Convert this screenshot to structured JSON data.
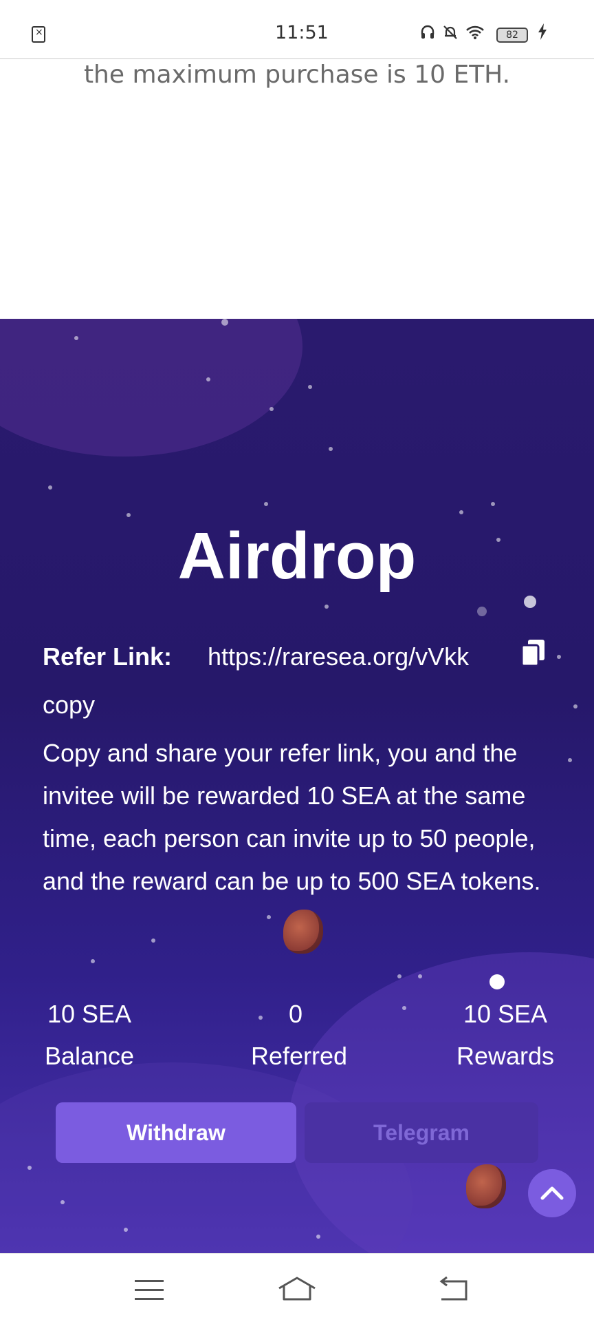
{
  "status_bar": {
    "time": "11:51",
    "battery": "82",
    "icons": [
      "document-x-icon",
      "headphones-icon",
      "bell-off-icon",
      "wifi-icon",
      "battery-icon",
      "charging-icon"
    ]
  },
  "page": {
    "top_text": "the maximum purchase is 10 ETH."
  },
  "airdrop": {
    "title": "Airdrop",
    "refer_label": "Refer Link:",
    "refer_link": "https://raresea.org/vVkk",
    "copy_text": "copy",
    "description": "Copy and share your refer link, you and the invitee will be rewarded 10 SEA at the same time, each person can invite up to 50 people, and the reward can be up to 500 SEA tokens.",
    "stats": [
      {
        "value": "10 SEA",
        "label": "Balance"
      },
      {
        "value": "0",
        "label": "Referred"
      },
      {
        "value": "10 SEA",
        "label": "Rewards"
      }
    ],
    "withdraw_label": "Withdraw",
    "telegram_label": "Telegram"
  },
  "colors": {
    "section_bg": "#26186a",
    "button_primary": "#7b5ce0",
    "button_disabled": "#4a31a3"
  }
}
